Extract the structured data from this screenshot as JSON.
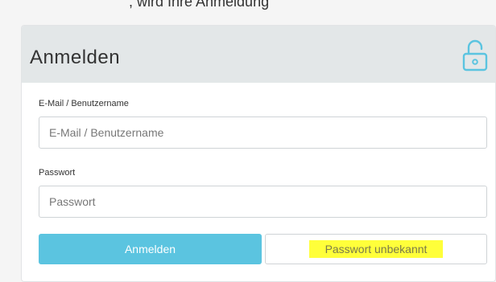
{
  "page": {
    "top_text": ", wird Ihre Anmeldung"
  },
  "login_card": {
    "title": "Anmelden",
    "header_icon": "unlocked-padlock-icon",
    "accent_color": "#5bc4e0",
    "username": {
      "label": "E-Mail / Benutzername",
      "placeholder": "E-Mail / Benutzername",
      "value": ""
    },
    "password": {
      "label": "Passwort",
      "placeholder": "Passwort",
      "value": ""
    },
    "submit_label": "Anmelden",
    "forgot_password_label": "Passwort unbekannt",
    "highlight_color": "#ffff3a"
  }
}
